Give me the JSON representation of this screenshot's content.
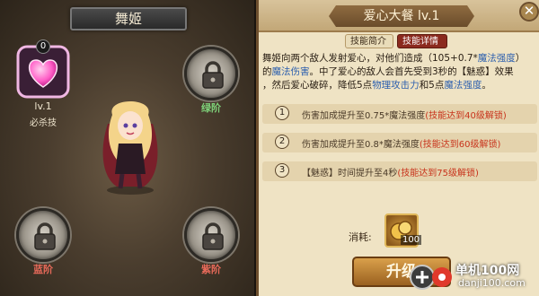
{
  "hero": {
    "name": "舞姬"
  },
  "ultimate": {
    "level_label": "lv.1",
    "caption": "必杀技",
    "badge_count": "0"
  },
  "slots": {
    "green": {
      "label": "绿阶",
      "color": "#7fd27a"
    },
    "blue": {
      "label": "蓝阶",
      "color": "#5aa7f2"
    },
    "purple": {
      "label": "紫阶",
      "color": "#d27ae0"
    }
  },
  "panel": {
    "title": "爱心大餐  lv.1",
    "close_label": "✕",
    "tabs": [
      {
        "label": "技能简介",
        "active": false
      },
      {
        "label": "技能详情",
        "active": true
      }
    ],
    "description": {
      "p1": "舞姬向两个敌人发射爱心，对他们造成（105+0.7*",
      "p1_blue": "魔法强度",
      "p1_end": "）",
      "p2_pre": "的",
      "p2_blue": "魔法伤害",
      "p2_rest": "。中了爱心的敌人会首先受到3秒的【魅惑】效果",
      "p3_pre": "，然后爱心破碎，降低5点",
      "p3_blue1": "物理攻击力",
      "p3_mid": "和5点",
      "p3_blue2": "魔法强度",
      "p3_end": "。"
    },
    "tiers": [
      {
        "num": "1",
        "text": "伤害加成提升至0.75*魔法强度",
        "lock": "(技能达到40级解锁)"
      },
      {
        "num": "2",
        "text": "伤害加成提升至0.8*魔法强度",
        "lock": "(技能达到60级解锁)"
      },
      {
        "num": "3",
        "text": "【魅惑】时间提升至4秒",
        "lock": "(技能达到75级解锁)"
      }
    ],
    "cost_label": "消耗:",
    "cost_count": "100",
    "upgrade_label": "升级"
  },
  "watermark": {
    "cn": "单机100网",
    "en": "danji100.com"
  }
}
